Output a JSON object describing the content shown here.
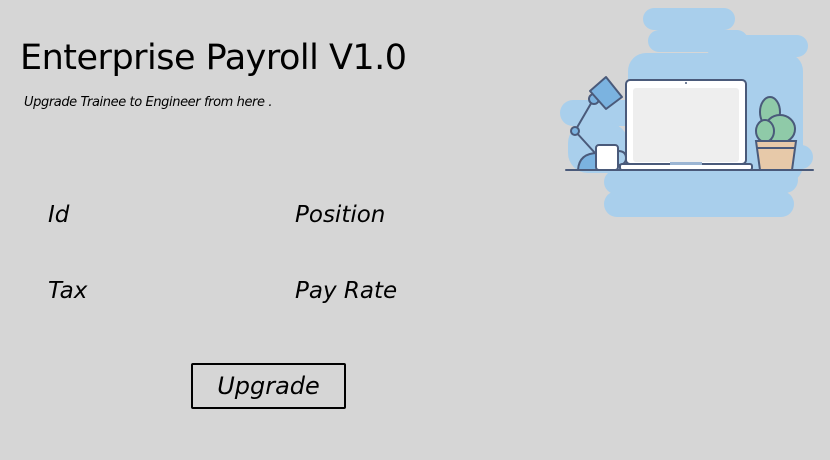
{
  "app": {
    "title": "Enterprise Payroll V1.0",
    "subtitle": "Upgrade Trainee to Engineer from here ."
  },
  "form": {
    "labels": {
      "id": "Id",
      "position": "Position",
      "tax": "Tax",
      "pay_rate": "Pay Rate"
    },
    "upgrade_button": "Upgrade"
  },
  "illustration": {
    "name": "workspace-illustration",
    "depicts": [
      "desk-lamp-icon",
      "coffee-mug-icon",
      "laptop-icon",
      "cactus-plant-icon"
    ],
    "colors": {
      "background_blob": "#a9cfec",
      "outline": "#4a5a7a",
      "screen": "#eeeeee",
      "plant": "#8fcaa8",
      "pot": "#e7c9a9",
      "lamp": "#7bb3e0"
    }
  },
  "colors": {
    "page_background": "#d6d6d6",
    "text": "#000000"
  }
}
